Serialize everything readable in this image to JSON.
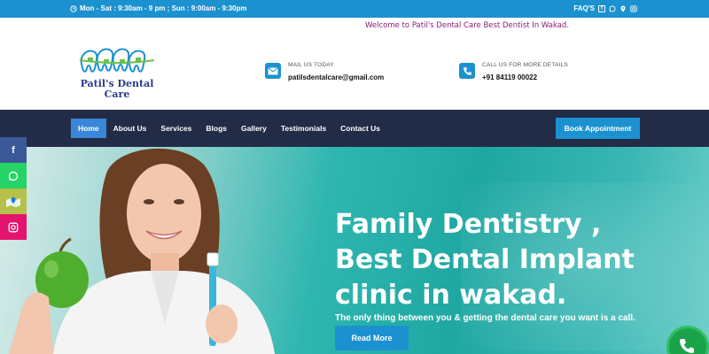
{
  "topbar": {
    "hours": "Mon - Sat : 9:30am - 9 pm ; Sun : 9:00am - 9:30pm",
    "faq": "FAQ'S",
    "icons": [
      "clock-icon",
      "facebook-icon",
      "whatsapp-icon",
      "location-icon",
      "instagram-icon"
    ]
  },
  "marquee": {
    "text": "Welcome to Patil's Dental Care Best Dentist In Wakad."
  },
  "logo": {
    "text_line1": "Patil's Dental",
    "text_line2": "Care"
  },
  "contact": {
    "mail_label": "MAIL US TODAY",
    "mail_value": "patilsdentalcare@gmail.com",
    "phone_label": "CALL US FOR MORE DETAILS",
    "phone_value": "+91 84119 00022"
  },
  "nav": {
    "items": [
      {
        "label": "Home"
      },
      {
        "label": "About Us"
      },
      {
        "label": "Services"
      },
      {
        "label": "Blogs"
      },
      {
        "label": "Gallery"
      },
      {
        "label": "Testimonials"
      },
      {
        "label": "Contact Us"
      }
    ],
    "cta": "Book Appointment"
  },
  "hero": {
    "title": "Family Dentistry , Best Dental Implant clinic in wakad.",
    "subtitle": "The only thing between you & getting the dental care you want is a call.",
    "button": "Read More"
  },
  "colors": {
    "brand_blue": "#1c91d0",
    "nav_dark": "#232c47",
    "facebook": "#3b5998",
    "whatsapp": "#25d366",
    "maps": "#f2c94c",
    "instagram": "#e4146e"
  }
}
